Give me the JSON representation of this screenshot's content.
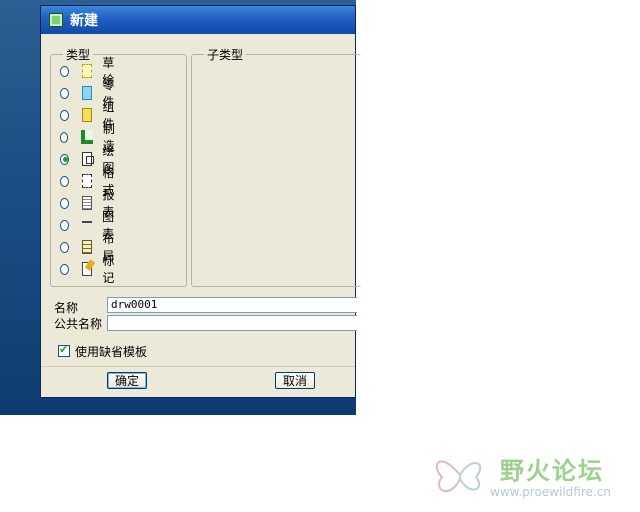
{
  "dialog": {
    "title": "新建",
    "type_group_label": "类型",
    "subtype_group_label": "子类型",
    "types": [
      {
        "label": "草绘",
        "icon": "sketch-icon",
        "selected": false
      },
      {
        "label": "零件",
        "icon": "part-icon",
        "selected": false
      },
      {
        "label": "组件",
        "icon": "assembly-icon",
        "selected": false
      },
      {
        "label": "制造",
        "icon": "manufacturing-icon",
        "selected": false
      },
      {
        "label": "绘图",
        "icon": "drawing-icon",
        "selected": true
      },
      {
        "label": "格式",
        "icon": "format-icon",
        "selected": false
      },
      {
        "label": "报表",
        "icon": "report-icon",
        "selected": false
      },
      {
        "label": "图表",
        "icon": "diagram-icon",
        "selected": false
      },
      {
        "label": "布局",
        "icon": "layout-icon",
        "selected": false
      },
      {
        "label": "标记",
        "icon": "markup-icon",
        "selected": false
      }
    ],
    "name_label": "名称",
    "name_value": "drw0001",
    "common_name_label": "公共名称",
    "common_name_value": "",
    "use_default_template_label": "使用缺省模板",
    "use_default_template_checked": true,
    "ok_label": "确定",
    "cancel_label": "取消"
  },
  "watermark": {
    "title": "野火论坛",
    "url": "www.proewildfire.cn"
  }
}
